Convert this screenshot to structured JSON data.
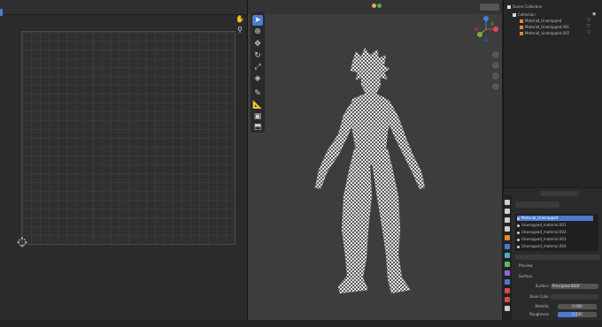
{
  "colors": {
    "accent": "#4a7bd0",
    "gizmo_x": "#e0484f",
    "gizmo_y": "#76b332",
    "gizmo_z": "#3d82e0"
  },
  "viewport": {
    "toolbar_icons": [
      "cursor-arrow-icon",
      "cursor-3d-icon",
      "move-icon",
      "rotate-icon",
      "scale-icon",
      "transform-icon",
      "annotate-icon",
      "measure-icon",
      "add-cube-icon",
      "extrude-icon"
    ],
    "gizmo_axes": [
      "X",
      "Y",
      "Z"
    ]
  },
  "outliner": {
    "rows": [
      "Scene Collection",
      "Collection",
      "Material_Unwrapped",
      "Material_Unwrapped.001",
      "Material_Unwrapped.002"
    ]
  },
  "properties": {
    "material_list": [
      "Material_Unwrapped",
      "Unwrapped_material.001",
      "Unwrapped_material.002",
      "Unwrapped_material.003",
      "Unwrapped_material.004"
    ],
    "sections": [
      "Preview",
      "Surface"
    ],
    "fields": [
      {
        "label": "Surface",
        "value": "Principled BSDF"
      },
      {
        "label": "Base Color",
        "value": ""
      },
      {
        "label": "Metallic",
        "value": "0.000"
      },
      {
        "label": "Roughness",
        "value": "0.500"
      }
    ]
  }
}
